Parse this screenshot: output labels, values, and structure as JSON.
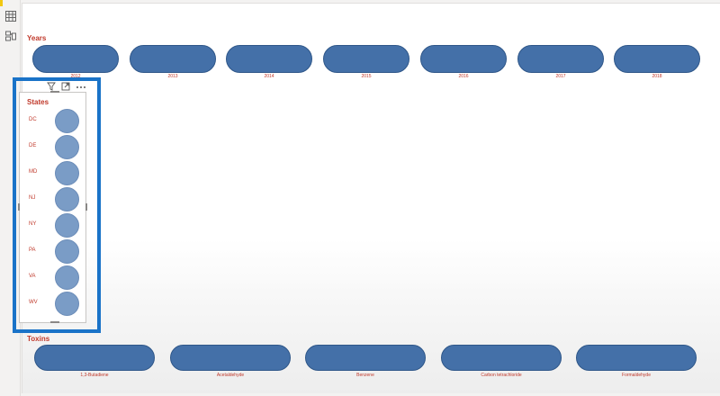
{
  "years": {
    "title": "Years",
    "items": [
      "2012",
      "2013",
      "2014",
      "2015",
      "2016",
      "2017",
      "2018"
    ]
  },
  "states": {
    "title": "States",
    "items": [
      "DC",
      "DE",
      "MD",
      "NJ",
      "NY",
      "PA",
      "VA",
      "WV"
    ]
  },
  "toxins": {
    "title": "Toxins",
    "items": [
      "1,3-Butadiene",
      "Acetaldehyde",
      "Benzene",
      "Carbon tetrachloride",
      "Formaldehyde"
    ]
  },
  "visual_header": {
    "filter_icon": "filter-icon",
    "focus_icon": "focus-mode-icon",
    "more_icon": "more-options-icon"
  },
  "colors": {
    "pill_fill": "#4470a8",
    "circle_fill": "#7a9cc6",
    "label_red": "#c0392b",
    "highlight_blue": "#1a73c8"
  }
}
